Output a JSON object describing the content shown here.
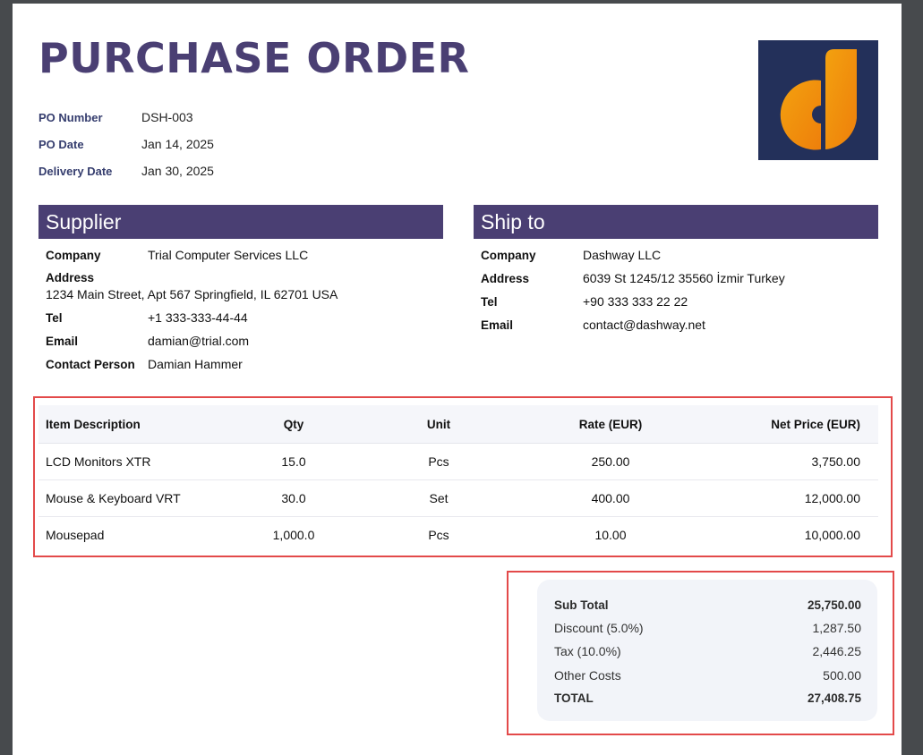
{
  "doc": {
    "title": "PURCHASE ORDER"
  },
  "meta": [
    {
      "label": "PO Number",
      "value": "DSH-003"
    },
    {
      "label": "PO Date",
      "value": "Jan 14, 2025"
    },
    {
      "label": "Delivery Date",
      "value": "Jan 30, 2025"
    }
  ],
  "supplier": {
    "heading": "Supplier",
    "company_label": "Company",
    "company": "Trial Computer Services LLC",
    "address_label": "Address",
    "address": "1234 Main Street, Apt 567 Springfield, IL 62701 USA",
    "tel_label": "Tel",
    "tel": "+1 333-333-44-44",
    "email_label": "Email",
    "email": "damian@trial.com",
    "contact_label": "Contact Person",
    "contact": "Damian Hammer"
  },
  "shipto": {
    "heading": "Ship to",
    "company_label": "Company",
    "company": "Dashway LLC",
    "address_label": "Address",
    "address": "6039 St 1245/12 35560 İzmir Turkey",
    "tel_label": "Tel",
    "tel": "+90 333 333 22 22",
    "email_label": "Email",
    "email": "contact@dashway.net"
  },
  "items": {
    "headers": [
      "Item Description",
      "Qty",
      "Unit",
      "Rate (EUR)",
      "Net Price (EUR)"
    ],
    "rows": [
      [
        "LCD Monitors XTR",
        "15.0",
        "Pcs",
        "250.00",
        "3,750.00"
      ],
      [
        "Mouse & Keyboard VRT",
        "30.0",
        "Set",
        "400.00",
        "12,000.00"
      ],
      [
        "Mousepad",
        "1,000.0",
        "Pcs",
        "10.00",
        "10,000.00"
      ]
    ]
  },
  "totals": [
    {
      "label": "Sub Total",
      "value": "25,750.00"
    },
    {
      "label": "Discount (5.0%)",
      "value": "1,287.50"
    },
    {
      "label": "Tax (10.0%)",
      "value": "2,446.25"
    },
    {
      "label": "Other Costs",
      "value": "500.00"
    },
    {
      "label": "TOTAL",
      "value": "27,408.75"
    }
  ],
  "colors": {
    "brand": "#4a3f73",
    "logo_bg": "#23305a",
    "logo_orange": "#f0900c",
    "highlight": "#e34a4a"
  },
  "icons": {
    "logo": "dashway-logo"
  }
}
